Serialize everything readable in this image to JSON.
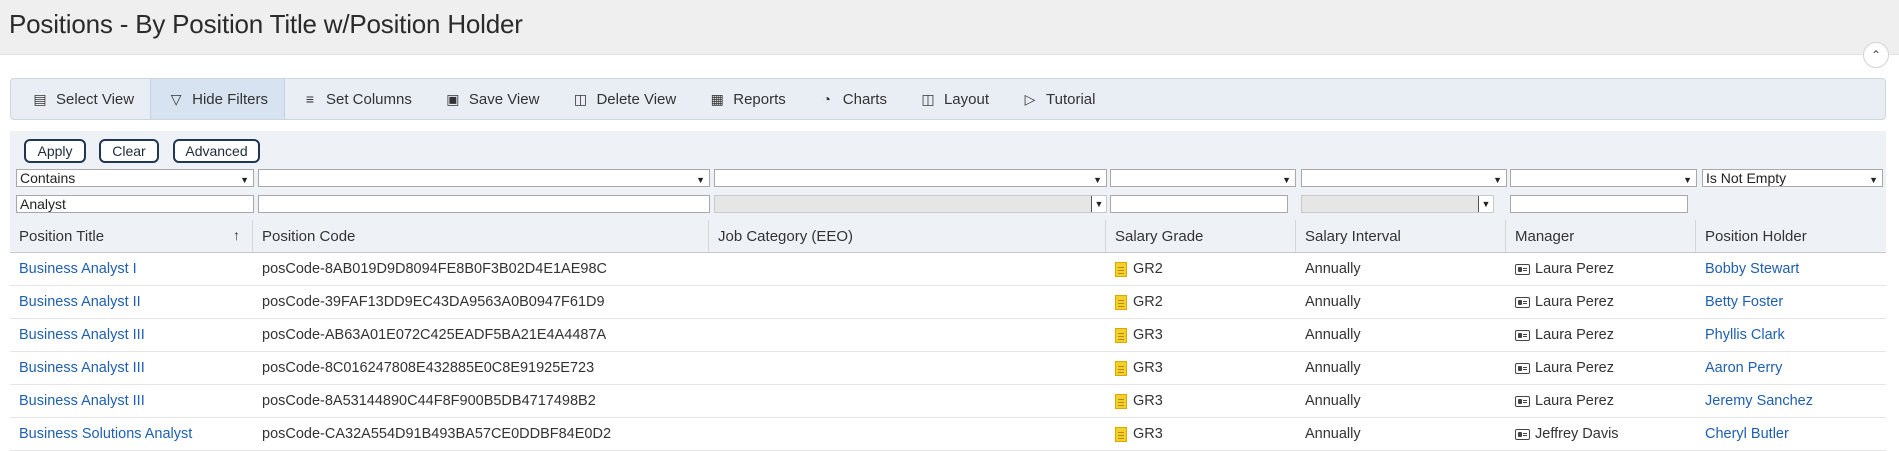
{
  "page": {
    "title": "Positions - By Position Title w/Position Holder"
  },
  "toolbar": {
    "items": [
      {
        "label": "Select View",
        "icon": "list-icon"
      },
      {
        "label": "Hide Filters",
        "icon": "filter-off-icon",
        "active": true
      },
      {
        "label": "Set Columns",
        "icon": "columns-icon"
      },
      {
        "label": "Save View",
        "icon": "save-icon"
      },
      {
        "label": "Delete View",
        "icon": "trash-icon"
      },
      {
        "label": "Reports",
        "icon": "report-icon"
      },
      {
        "label": "Charts",
        "icon": "pie-chart-icon"
      },
      {
        "label": "Layout",
        "icon": "layout-icon"
      },
      {
        "label": "Tutorial",
        "icon": "video-icon"
      }
    ]
  },
  "filters": {
    "apply_label": "Apply",
    "clear_label": "Clear",
    "advanced_label": "Advanced",
    "operators": [
      "Contains",
      "",
      "",
      "",
      "",
      "",
      "Is Not Empty"
    ],
    "values": [
      "Analyst",
      "",
      "",
      "",
      "",
      "",
      ""
    ]
  },
  "grid": {
    "columns": [
      "Position Title",
      "Position Code",
      "Job Category (EEO)",
      "Salary Grade",
      "Salary Interval",
      "Manager",
      "Position Holder"
    ],
    "sorted_column": "Position Title",
    "sort_direction": "ascending",
    "rows": [
      [
        "Business Analyst I",
        "posCode-8AB019D9D8094FE8B0F3B02D4E1AE98C",
        "",
        "GR2",
        "Annually",
        "Laura Perez",
        "Bobby Stewart"
      ],
      [
        "Business Analyst II",
        "posCode-39FAF13DD9EC43DA9563A0B0947F61D9",
        "",
        "GR2",
        "Annually",
        "Laura Perez",
        "Betty Foster"
      ],
      [
        "Business Analyst III",
        "posCode-AB63A01E072C425EADF5BA21E4A4487A",
        "",
        "GR3",
        "Annually",
        "Laura Perez",
        "Phyllis Clark"
      ],
      [
        "Business Analyst III",
        "posCode-8C016247808E432885E0C8E91925E723",
        "",
        "GR3",
        "Annually",
        "Laura Perez",
        "Aaron Perry"
      ],
      [
        "Business Analyst III",
        "posCode-8A53144890C44F8F900B5DB4717498B2",
        "",
        "GR3",
        "Annually",
        "Laura Perez",
        "Jeremy Sanchez"
      ],
      [
        "Business Solutions Analyst",
        "posCode-CA32A554D91B493BA57CE0DDBF84E0D2",
        "",
        "GR3",
        "Annually",
        "Jeffrey Davis",
        "Cheryl Butler"
      ]
    ]
  }
}
